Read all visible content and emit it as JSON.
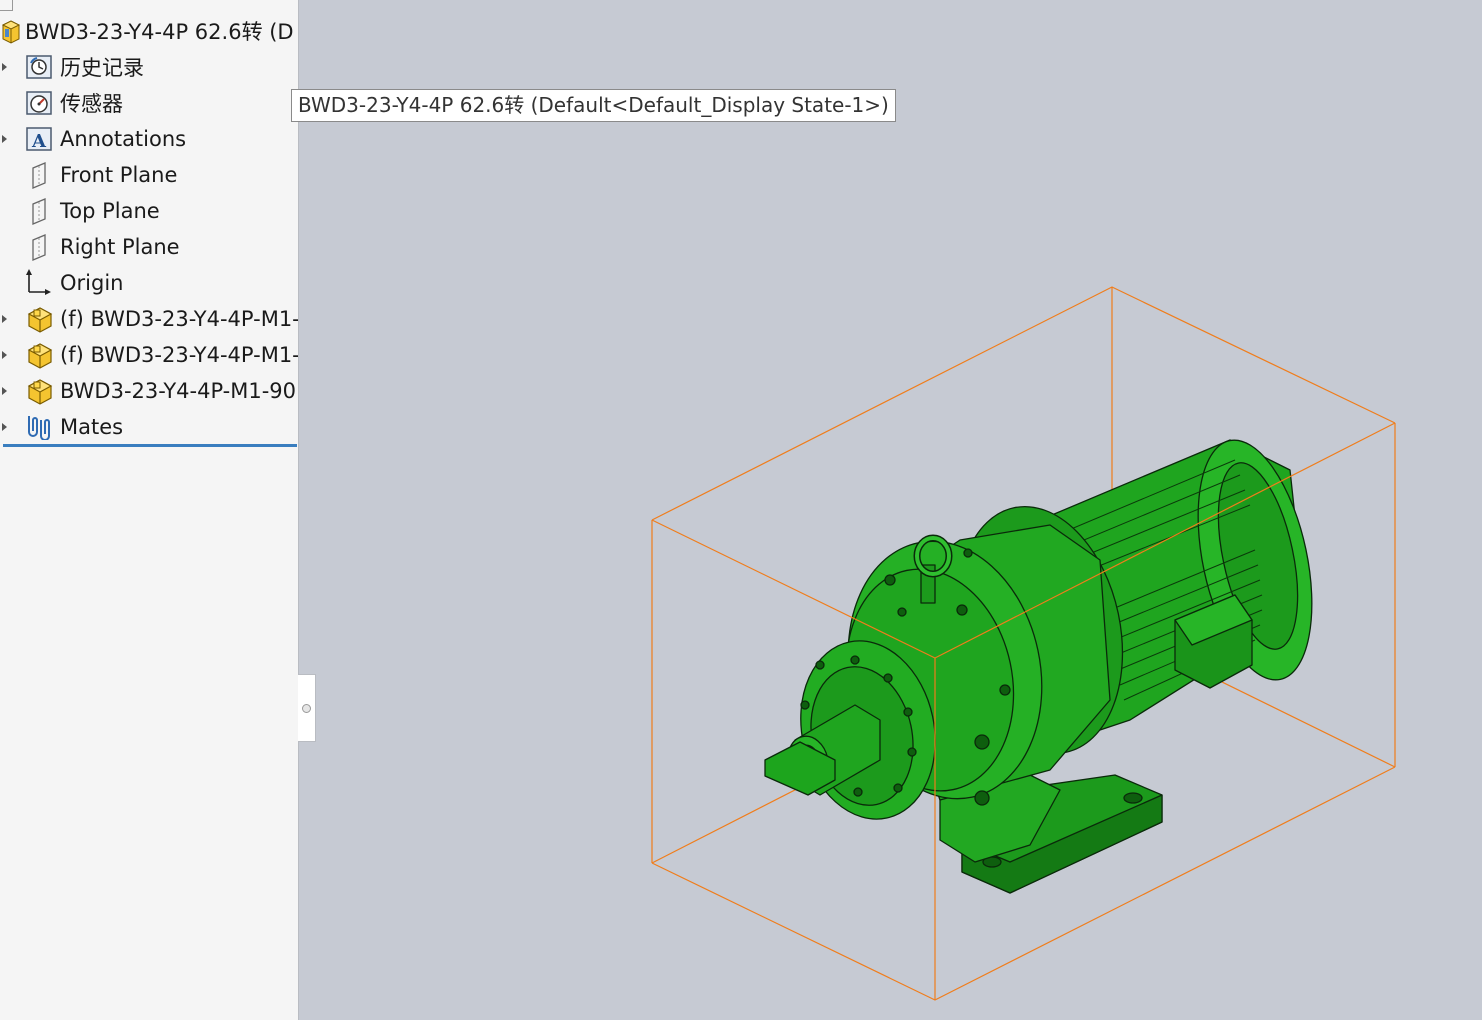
{
  "feature_tree": {
    "root_label": "BWD3-23-Y4-4P  62.6转  (D",
    "items": [
      {
        "label": "历史记录",
        "icon": "history-icon",
        "expandable": true
      },
      {
        "label": "传感器",
        "icon": "sensor-icon",
        "expandable": false
      },
      {
        "label": "Annotations",
        "icon": "annotations-icon",
        "expandable": true
      },
      {
        "label": "Front Plane",
        "icon": "plane-icon",
        "expandable": false
      },
      {
        "label": "Top Plane",
        "icon": "plane-icon",
        "expandable": false
      },
      {
        "label": "Right Plane",
        "icon": "plane-icon",
        "expandable": false
      },
      {
        "label": "Origin",
        "icon": "origin-icon",
        "expandable": false
      },
      {
        "label": "(f) BWD3-23-Y4-4P-M1-",
        "icon": "part-icon",
        "expandable": true
      },
      {
        "label": "(f) BWD3-23-Y4-4P-M1-",
        "icon": "part-icon",
        "expandable": true
      },
      {
        "label": "BWD3-23-Y4-4P-M1-90",
        "icon": "part-icon",
        "expandable": true
      },
      {
        "label": "Mates",
        "icon": "mates-icon",
        "expandable": true
      }
    ]
  },
  "tooltip": {
    "text": "BWD3-23-Y4-4P  62.6转  (Default<Default_Display State-1>)"
  },
  "viewport": {
    "background": "#c6cad3",
    "model_color": "#1fa51f",
    "selection_box_color": "#f07d1b"
  }
}
